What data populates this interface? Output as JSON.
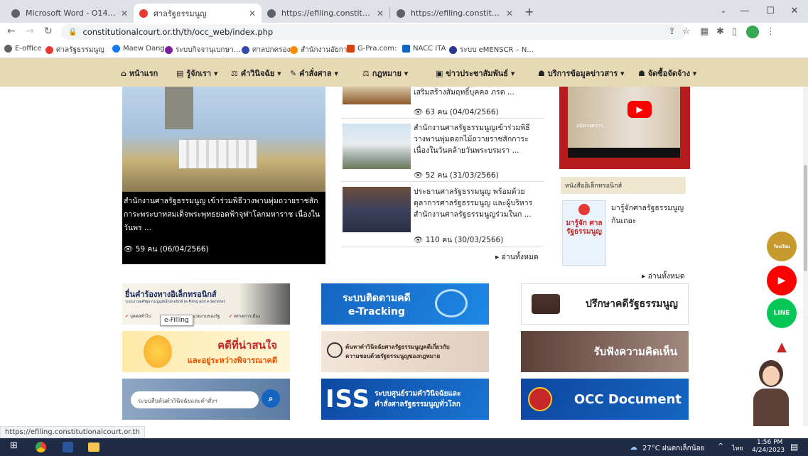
{
  "tabs": [
    {
      "title": "Microsoft Word - O14.docx",
      "color": "#5f6368"
    },
    {
      "title": "ศาลรัฐธรรมนูญ",
      "color": "#e53935"
    },
    {
      "title": "https://efiling.constitutionalcourt",
      "color": "#5f6368"
    },
    {
      "title": "https://efiling.constitutionalcourt",
      "color": "#5f6368"
    }
  ],
  "new_tab": "+",
  "url": "constitutionalcourt.or.th/th/occ_web/index.php",
  "bookmarks": [
    {
      "label": "E-office",
      "color": "#5f6368"
    },
    {
      "label": "ศาลรัฐธรรมนูญ",
      "color": "#e53935"
    },
    {
      "label": "Maew Dang",
      "color": "#1877f2"
    },
    {
      "label": "ระบบกิจจานุเบกษา...",
      "color": "#7b1fa2"
    },
    {
      "label": "ศาลปกครอง",
      "color": "#3949ab"
    },
    {
      "label": "สำนักงานอัยการ",
      "color": "#fb8c00"
    },
    {
      "label": "G-Pra.com:",
      "color": "#d84315"
    },
    {
      "label": "NACC ITA",
      "color": "#1565c0"
    },
    {
      "label": "ระบบ eMENSCR – N...",
      "color": "#283593"
    }
  ],
  "nav": [
    {
      "icon": "⌂",
      "label": "หน้าแรก"
    },
    {
      "icon": "▤",
      "label": "รู้จักเรา ▾"
    },
    {
      "icon": "⚖",
      "label": "คำวินิจฉัย ▾"
    },
    {
      "icon": "✎",
      "label": "คำสั่งศาล ▾"
    },
    {
      "icon": "⚖",
      "label": "กฎหมาย ▾"
    },
    {
      "icon": "▣",
      "label": "ข่าวประชาสัมพันธ์ ▾"
    },
    {
      "icon": "☗",
      "label": "บริการข้อมูลข่าวสาร ▾"
    },
    {
      "icon": "☗",
      "label": "จัดซื้อจัดจ้าง ▾"
    }
  ],
  "featured": {
    "title": "สำนักงานศาลรัฐธรรมนูญ เข้าร่วมพิธีวางพานพุ่มถวายราชสักการะพระบาทสมเด็จพระพุทธยอดฟ้าจุฬาโลกมหาราช เนื่องในวันพร ...",
    "views": "59 คน (06/04/2566)"
  },
  "news": [
    {
      "title": "เสริมสร้างสัมฤทธิ์บุคคล ภรต ...",
      "views": "63 คน (04/04/2566)"
    },
    {
      "title": "สำนักงานศาลรัฐธรรมนูญเข้าร่วมพิธีวางพานพุ่มดอกไม้ถวายราชสักการะเนื่องในวันคล้ายวันพระบรมรา ...",
      "views": "52 คน (31/03/2566)"
    },
    {
      "title": "ประธานศาลรัฐธรรมนูญ พร้อมด้วยตุลาการศาลรัฐธรรมนูญ และผู้บริหารสำนักงานศาลรัฐธรรมนูญร่วมในก ...",
      "views": "110 คน (30/03/2566)"
    }
  ],
  "read_all": "▸ อ่านทั้งหมด",
  "ebook": {
    "heading": "หนังสืออิเล็กทรอนิกส์",
    "title": "มารู้จักศาลรัฐธรรมนูญกันเถอะ",
    "cover_text": "มารู้จัก ศาล รัฐธรรมนูญ"
  },
  "video": {
    "caption": "อนิทรรศการ..."
  },
  "banners": {
    "efiling_title": "ยื่นคำร้องทางอิเล็กทรอนิกส์",
    "efiling_sub": "ระบบงานคดีรัฐธรรมนูญอิเล็กทรอนิกส์ (e-Filing and e-Service)",
    "efiling_tag1": "บุคคลทั่วไป",
    "efiling_tag2": "หน่วยงานของรัฐ",
    "efiling_tag3": "พรรคการเมือง",
    "tooltip": "e-Filling",
    "etracking_1": "ระบบติดตามคดี",
    "etracking_2": "e-Tracking",
    "advice": "ปรึกษาคดีรัฐธรรมนูญ",
    "interesting_1": "คดีที่น่าสนใจ",
    "interesting_2": "และอยู่ระหว่างพิจารณาคดี",
    "search_rel_1": "ค้นหาคำวินิจฉัยศาลรัฐธรรมนูญคดีเกี่ยวกับ",
    "search_rel_2": "ความชอบด้วยรัฐธรรมนูญของกฎหมาย",
    "opinion": "รับฟังความคิดเห็น",
    "search_placeholder": "ระบบสืบค้นคำวินิจฉัยและคำสั่งฯ",
    "iss_big": "ISS",
    "iss_1": "ระบบศูนย์รวมคำวินิจฉัยและ",
    "iss_2": "คำสั่งศาลรัฐธรรมนูญทั่วโลก",
    "occ": "OCC Document"
  },
  "status_url": "https://efiling.constitutionalcourt.or.th",
  "taskbar": {
    "weather": "27°C ฝนตกเล็กน้อย",
    "lang": "ไทย",
    "time": "1:56 PM",
    "date": "4/24/2023"
  },
  "float_buttons": {
    "line": "LINE",
    "complaint": "ร้องเรียน"
  },
  "colors": {
    "nav_bg": "#e8d9b5",
    "brand_red": "#c62828",
    "banner_blue": "#1565c0"
  }
}
